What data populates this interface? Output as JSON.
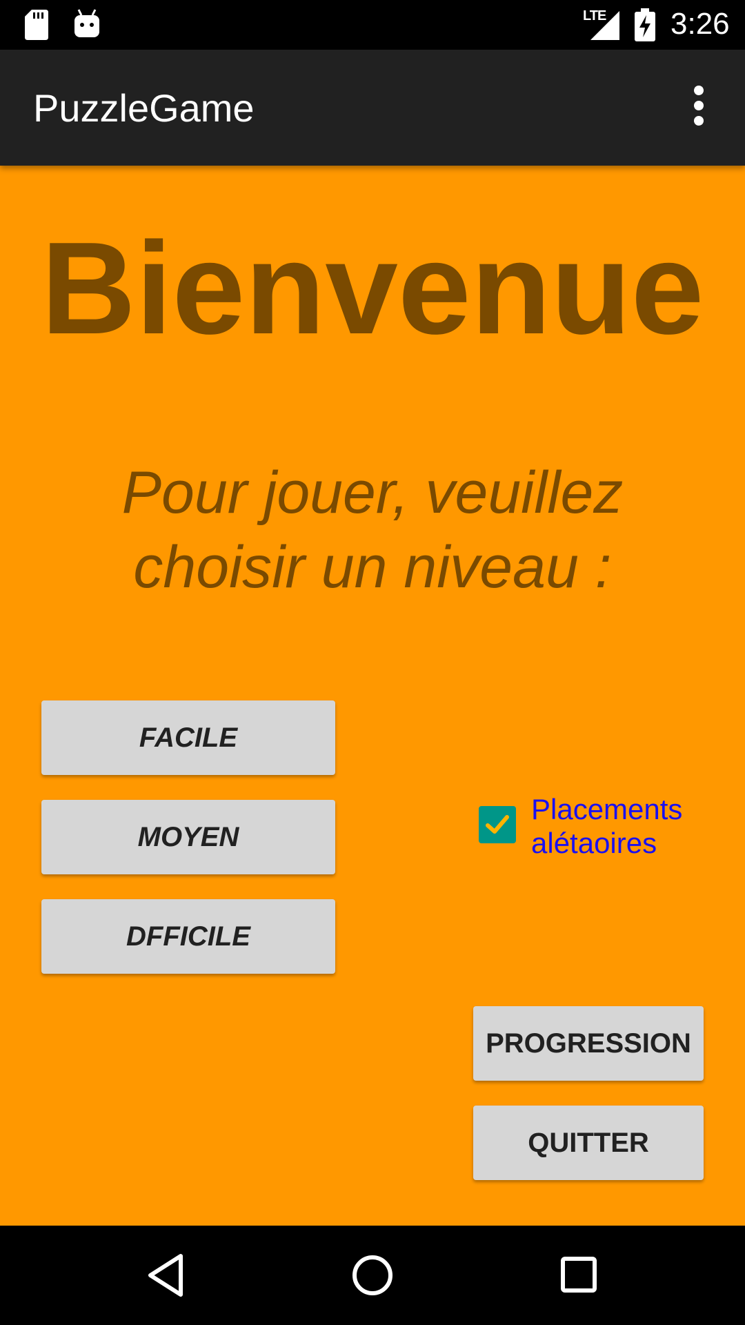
{
  "status_bar": {
    "network": "LTE",
    "time": "3:26",
    "icons": [
      "sd-card-icon",
      "android-debug-icon",
      "signal-icon",
      "battery-charging-icon"
    ]
  },
  "app_bar": {
    "title": "PuzzleGame",
    "menu_icon": "overflow-menu-icon"
  },
  "main": {
    "welcome": "Bienvenue",
    "instruction_line1": "Pour jouer, veuillez",
    "instruction_line2": "choisir un niveau :",
    "levels": {
      "easy": "FACILE",
      "medium": "MOYEN",
      "hard": "DFFICILE"
    },
    "random_placement": {
      "line1": "Placements",
      "line2": "alétaoires",
      "checked": true
    },
    "progression_label": "PROGRESSION",
    "quit_label": "QUITTER"
  },
  "nav_bar": {
    "icons": [
      "back-icon",
      "home-icon",
      "recent-apps-icon"
    ]
  },
  "colors": {
    "background": "#ff9800",
    "app_bar": "#212121",
    "heading_text": "#7a4a00",
    "button": "#d6d6d6",
    "checkbox": "#009688",
    "checkbox_label": "#1a10f0"
  }
}
